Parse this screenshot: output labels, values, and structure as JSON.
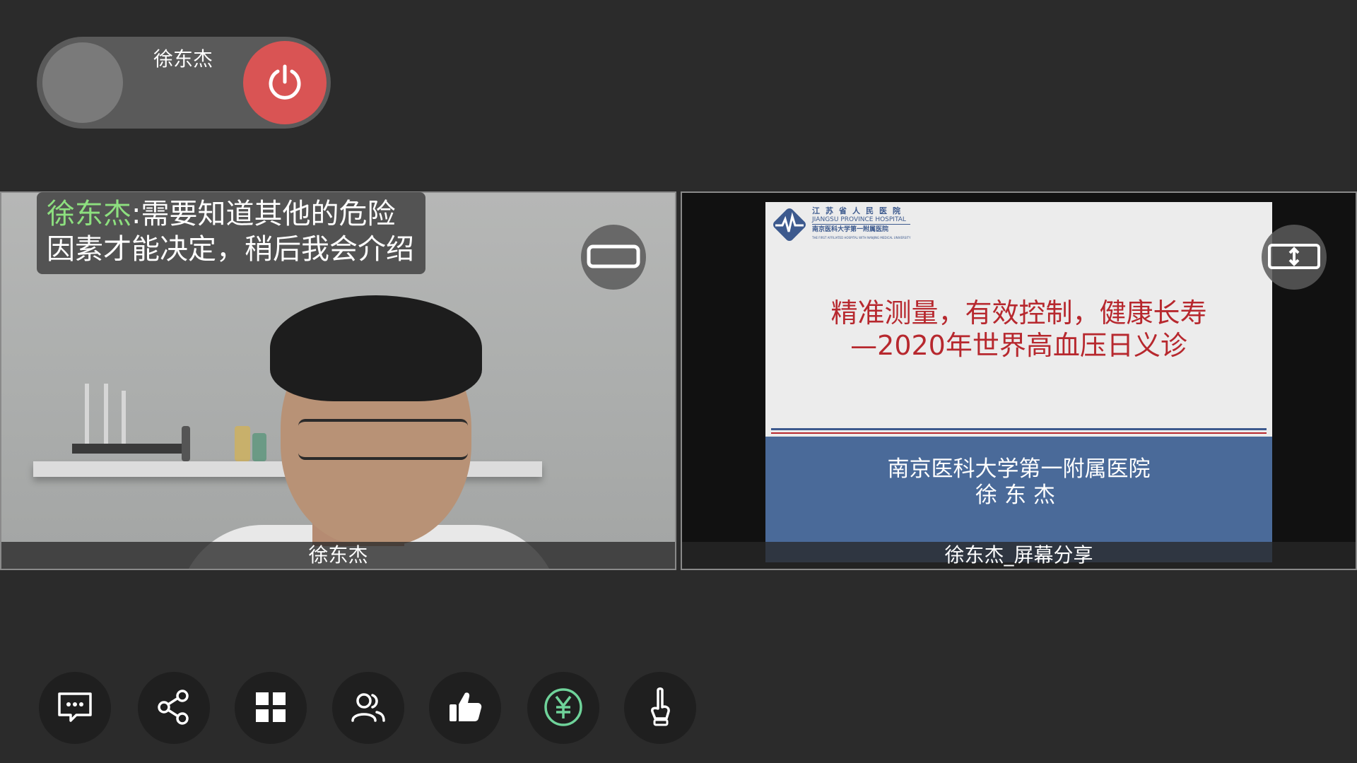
{
  "host": {
    "name": "徐东杰",
    "leave_icon": "power-icon"
  },
  "colors": {
    "leave_button": "#d95454",
    "chat_sender": "#8de07f",
    "slide_title": "#b7282e",
    "slide_footer": "#4a6a99"
  },
  "chat": {
    "sender": "徐东杰",
    "message": ":需要知道其他的危险因素才能决定，稍后我会介绍"
  },
  "video_left": {
    "label": "徐东杰",
    "toggle_icon": "layout-toggle-icon"
  },
  "video_right": {
    "label": "徐东杰_屏幕分享",
    "toggle_icon": "expand-vertical-icon",
    "slide": {
      "logo": {
        "line1": "江苏省人民医院",
        "line2": "JIANGSU PROVINCE HOSPITAL",
        "line3": "南京医科大学第一附属医院",
        "line4": "THE FIRST AFFILIATED HOSPITAL WITH NANJING MEDICAL UNIVERSITY"
      },
      "title_line1": "精准测量，有效控制，健康长寿",
      "title_line2": "—2020年世界高血压日义诊",
      "org": "南京医科大学第一附属医院",
      "author": "徐东杰"
    }
  },
  "toolbar": [
    {
      "icon": "chat-icon"
    },
    {
      "icon": "share-icon"
    },
    {
      "icon": "grid-icon"
    },
    {
      "icon": "participants-icon"
    },
    {
      "icon": "thumbs-up-icon"
    },
    {
      "icon": "yuan-icon"
    },
    {
      "icon": "raise-hand-icon"
    }
  ]
}
